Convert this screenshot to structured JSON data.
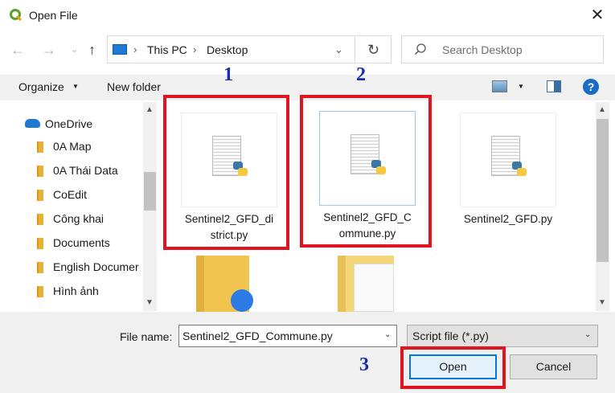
{
  "window": {
    "title": "Open File"
  },
  "address": {
    "crumbs": [
      "This PC",
      "Desktop"
    ]
  },
  "search": {
    "placeholder": "Search Desktop"
  },
  "toolbar": {
    "organize": "Organize",
    "new_folder": "New folder",
    "help": "?"
  },
  "sidebar": {
    "root": "OneDrive",
    "items": [
      "0A Map",
      "0A Thái Data",
      "CoEdit",
      "Công khai",
      "Documents",
      "English Documer",
      "Hình ảnh"
    ]
  },
  "files": [
    {
      "name_line1": "Sentinel2_GFD_di",
      "name_line2": "strict.py"
    },
    {
      "name_line1": "Sentinel2_GFD_C",
      "name_line2": "ommune.py"
    },
    {
      "name_line1": "Sentinel2_GFD.py",
      "name_line2": ""
    }
  ],
  "bottom": {
    "file_name_label": "File name:",
    "file_name_value": "Sentinel2_GFD_Commune.py",
    "filter": "Script file (*.py)",
    "open": "Open",
    "cancel": "Cancel"
  },
  "annotations": [
    "1",
    "2",
    "3"
  ],
  "colors": {
    "annotation_box": "#e0141e",
    "annotation_number": "#1c2ea6",
    "accent": "#0078d7"
  },
  "icons": [
    "qgis-icon",
    "close-icon",
    "back-arrow-icon",
    "forward-arrow-icon",
    "up-arrow-icon",
    "refresh-icon",
    "search-icon",
    "onedrive-icon",
    "folder-icon",
    "python-file-icon",
    "help-icon"
  ]
}
